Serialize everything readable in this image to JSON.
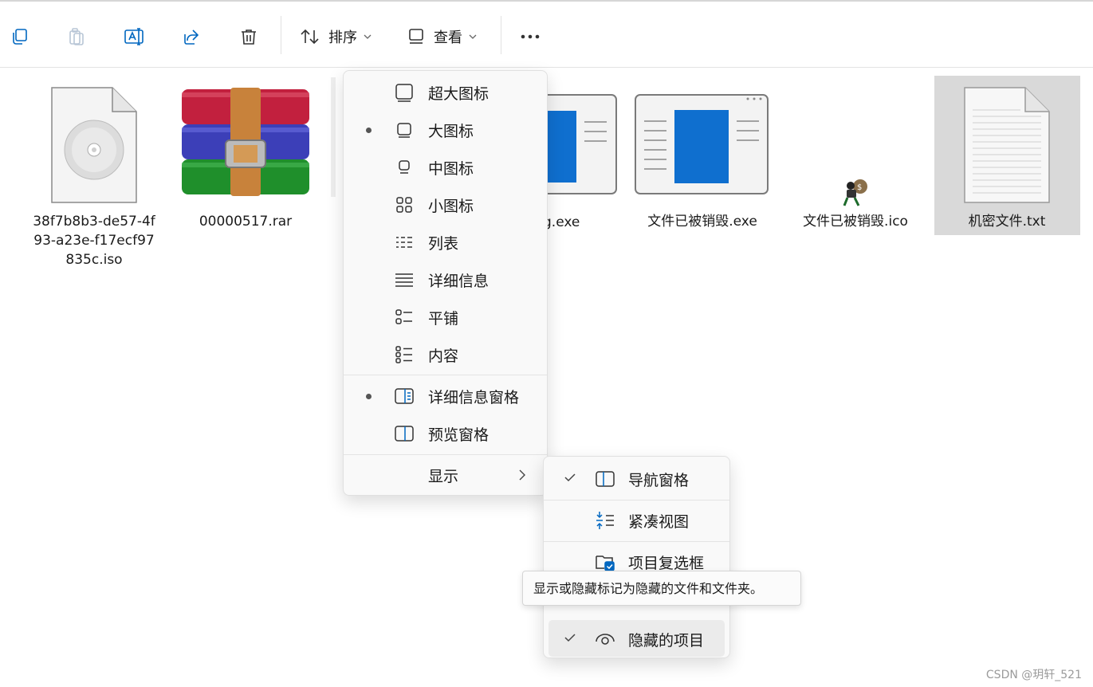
{
  "toolbar": {
    "sort_label": "排序",
    "view_label": "查看"
  },
  "files": [
    {
      "name": "38f7b8b3-de57-4f\n93-a23e-f17ecf97\n835c.iso",
      "icon": "disc-image-icon"
    },
    {
      "name": "00000517.rar",
      "icon": "winrar-archive-icon"
    },
    {
      "name": "g.exe",
      "icon": "app-window-icon"
    },
    {
      "name": "文件已被销毁.exe",
      "icon": "app-window-icon"
    },
    {
      "name": "文件已被销毁.ico",
      "icon": "thief-icon"
    },
    {
      "name": "机密文件.txt",
      "icon": "text-document-icon",
      "selected": true
    }
  ],
  "view_menu": {
    "items": [
      {
        "label": "超大图标",
        "icon": "extra-large-icons-icon",
        "bullet": false
      },
      {
        "label": "大图标",
        "icon": "large-icons-icon",
        "bullet": true
      },
      {
        "label": "中图标",
        "icon": "medium-icons-icon",
        "bullet": false
      },
      {
        "label": "小图标",
        "icon": "small-icons-icon",
        "bullet": false
      },
      {
        "label": "列表",
        "icon": "list-icon",
        "bullet": false
      },
      {
        "label": "详细信息",
        "icon": "details-icon",
        "bullet": false
      },
      {
        "label": "平铺",
        "icon": "tiles-icon",
        "bullet": false
      },
      {
        "label": "内容",
        "icon": "content-icon",
        "bullet": false
      },
      {
        "label": "详细信息窗格",
        "icon": "details-pane-icon",
        "bullet": true
      },
      {
        "label": "预览窗格",
        "icon": "preview-pane-icon",
        "bullet": false
      }
    ],
    "show_label": "显示"
  },
  "show_submenu": {
    "items": [
      {
        "label": "导航窗格",
        "icon": "navigation-pane-icon",
        "checked": true
      },
      {
        "label": "紧凑视图",
        "icon": "compact-view-icon",
        "checked": false
      },
      {
        "label": "项目复选框",
        "icon": "item-checkbox-icon",
        "checked": false
      },
      {
        "label": "隐藏的项目",
        "icon": "eye-icon",
        "checked": true
      }
    ]
  },
  "tooltip": "显示或隐藏标记为隐藏的文件和文件夹。",
  "watermark": "CSDN @玥轩_521",
  "colors": {
    "accent": "#0067c0",
    "selected_bg": "#d9d9d9"
  }
}
